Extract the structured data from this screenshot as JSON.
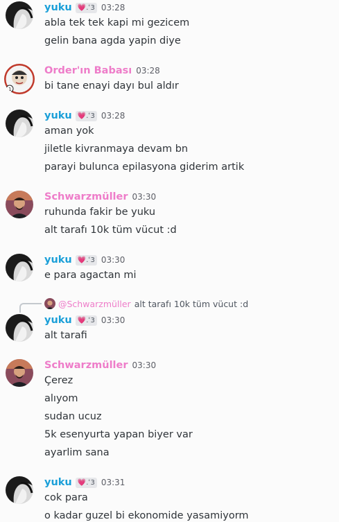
{
  "messages": [
    {
      "author": "yuku",
      "badge": "💗.ʿ3",
      "time": "03:28",
      "lines": [
        "abla tek tek kapi mi gezicem",
        "gelin bana agda yapin diye"
      ]
    },
    {
      "author": "Order'ın Babası",
      "time": "03:28",
      "lines": [
        "bi tane enayi dayı bul aldır"
      ]
    },
    {
      "author": "yuku",
      "badge": "💗.ʿ3",
      "time": "03:28",
      "lines": [
        "aman yok",
        "jiletle kivranmaya devam bn",
        "parayi bulunca epilasyona giderim artik"
      ]
    },
    {
      "author": "Schwarzmüller",
      "time": "03:30",
      "lines": [
        "ruhunda fakir be yuku",
        "alt tarafı 10k tüm vücut :d"
      ]
    },
    {
      "author": "yuku",
      "badge": "💗.ʿ3",
      "time": "03:30",
      "lines": [
        "e para agactan mi"
      ]
    },
    {
      "author": "yuku",
      "badge": "💗.ʿ3",
      "time": "03:30",
      "reply": {
        "author": "@Schwarzmüller",
        "text": "alt tarafı 10k tüm vücut :d"
      },
      "lines": [
        "alt tarafi"
      ]
    },
    {
      "author": "Schwarzmüller",
      "time": "03:30",
      "lines": [
        "Çerez",
        "alıyom",
        "sudan ucuz",
        "5k esenyurta yapan biyer var",
        "ayarlim sana"
      ]
    },
    {
      "author": "yuku",
      "badge": "💗.ʿ3",
      "time": "03:31",
      "lines": [
        "cok para",
        "o kadar guzel bi ekonomide yasamiyorm"
      ]
    }
  ],
  "colors": {
    "yuku": "#1a9fd8",
    "pink_role": "#ee7cc9",
    "text": "#2e3338",
    "time": "#5c5e66",
    "background": "#fbfbfb"
  },
  "icons": {
    "badge_heart": "heart-emoji-icon",
    "reply_connector": "reply-spine-icon"
  }
}
